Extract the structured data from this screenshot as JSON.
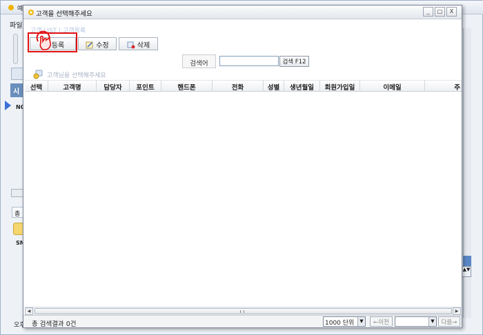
{
  "background_app": {
    "title": "예",
    "menu_file": "파일",
    "panel_head": "시",
    "pointer_label": "NO",
    "tab_label": "총",
    "row_label": "SM",
    "status_left": "오후"
  },
  "dialog": {
    "title": "고객을 선택해주세요",
    "window_buttons": {
      "minimize": "_",
      "maximize": "□",
      "close": "X"
    },
    "breadcrumb": "고객 LIST | 고객목록",
    "toolbar": {
      "register_label": "등록",
      "edit_label": "수정",
      "delete_label": "삭제"
    },
    "search": {
      "label": "검색어",
      "value": "",
      "button_label": "검색 F12"
    },
    "hint": "고객님을 선택해주세요",
    "grid": {
      "columns": [
        "선택",
        "고객명",
        "담당자",
        "포인트",
        "핸드폰",
        "전화",
        "성별",
        "생년월일",
        "회원가입일",
        "이메일",
        "주"
      ],
      "rows": []
    },
    "status": {
      "result_text": "총 검색결과 0건",
      "page_size": "1000 단위",
      "prev_label": "←이전",
      "page_value": "",
      "next_label": "다음→"
    }
  },
  "colors": {
    "highlight": "#e01010",
    "accent_blue": "#5a86c6",
    "hint_text": "#a7b1c2"
  },
  "icons": [
    "logo-icon",
    "register-icon",
    "edit-icon",
    "delete-icon",
    "hint-icon",
    "hand-cursor-icon",
    "dropdown-arrow-icon",
    "scroll-left-icon",
    "scroll-right-icon"
  ]
}
